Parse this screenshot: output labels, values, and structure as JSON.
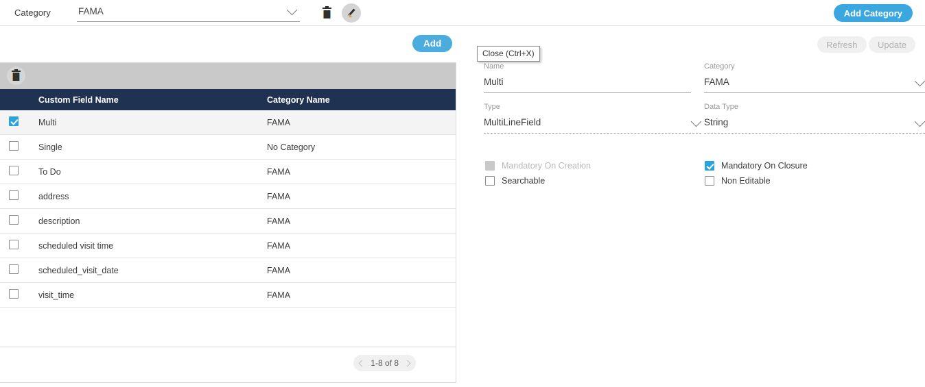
{
  "topbar": {
    "category_label": "Category",
    "category_value": "FAMA",
    "delete_icon": "trash-icon",
    "edit_icon": "pencil-icon",
    "add_category_label": "Add Category"
  },
  "actions": {
    "add_label": "Add",
    "refresh_label": "Refresh",
    "update_label": "Update"
  },
  "grid": {
    "toolbar_delete_icon": "trash-icon",
    "columns": [
      "",
      "Custom Field Name",
      "Category Name"
    ],
    "rows": [
      {
        "selected": true,
        "name": "Multi",
        "category": "FAMA"
      },
      {
        "selected": false,
        "name": "Single",
        "category": "No Category"
      },
      {
        "selected": false,
        "name": "To Do",
        "category": "FAMA"
      },
      {
        "selected": false,
        "name": "address",
        "category": "FAMA"
      },
      {
        "selected": false,
        "name": "description",
        "category": "FAMA"
      },
      {
        "selected": false,
        "name": "scheduled visit time",
        "category": "FAMA"
      },
      {
        "selected": false,
        "name": "scheduled_visit_date",
        "category": "FAMA"
      },
      {
        "selected": false,
        "name": "visit_time",
        "category": "FAMA"
      }
    ],
    "pager": {
      "label": "1-8 of 8",
      "prev_icon": "chevron-left-icon",
      "next_icon": "chevron-right-icon"
    }
  },
  "detail": {
    "tooltip": "Close (Ctrl+X)",
    "fields": {
      "name": {
        "label": "Name",
        "value": "Multi"
      },
      "category": {
        "label": "Category",
        "value": "FAMA"
      },
      "type": {
        "label": "Type",
        "value": "MultiLineField"
      },
      "data_type": {
        "label": "Data Type",
        "value": "String"
      }
    },
    "checkboxes": {
      "mandatory_on_creation": {
        "label": "Mandatory On Creation",
        "checked": false,
        "disabled": true
      },
      "searchable": {
        "label": "Searchable",
        "checked": false,
        "disabled": false
      },
      "mandatory_on_closure": {
        "label": "Mandatory On Closure",
        "checked": true,
        "disabled": false
      },
      "non_editable": {
        "label": "Non Editable",
        "checked": false,
        "disabled": false
      }
    }
  },
  "colors": {
    "accent_blue": "#3ba7e0",
    "header_navy": "#1f3251",
    "toolbar_gray": "#c9c9c9",
    "checked_blue": "#29a3dc"
  }
}
